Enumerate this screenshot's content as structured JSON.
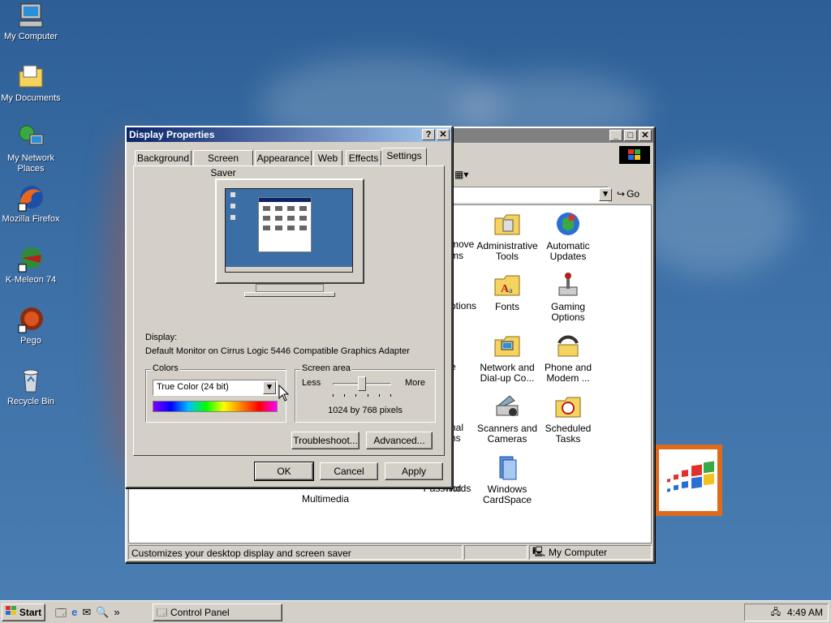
{
  "desktop": {
    "icons": [
      {
        "label": "My Computer",
        "icon": "my-computer-icon"
      },
      {
        "label": "My Documents",
        "icon": "my-documents-icon"
      },
      {
        "label": "My Network Places",
        "icon": "network-places-icon"
      },
      {
        "label": "Mozilla Firefox",
        "icon": "firefox-icon"
      },
      {
        "label": "K-Meleon 74",
        "icon": "k-meleon-icon"
      },
      {
        "label": "Pego",
        "icon": "pego-icon"
      },
      {
        "label": "Recycle Bin",
        "icon": "recycle-bin-icon"
      }
    ]
  },
  "control_panel": {
    "go_label": "Go",
    "status_left": "Customizes your desktop display and screen saver",
    "status_right": "My Computer",
    "items": [
      {
        "label": "Administrative Tools",
        "icon": "admin-tools-icon"
      },
      {
        "label": "Automatic Updates",
        "icon": "automatic-updates-icon"
      },
      {
        "label": "Fonts",
        "icon": "fonts-icon"
      },
      {
        "label": "Gaming Options",
        "icon": "gaming-options-icon"
      },
      {
        "label": "Network and Dial-up Co...",
        "icon": "network-dialup-icon"
      },
      {
        "label": "Phone and Modem ...",
        "icon": "phone-modem-icon"
      },
      {
        "label": "Scanners and Cameras",
        "icon": "scanners-cameras-icon"
      },
      {
        "label": "Scheduled Tasks",
        "icon": "scheduled-tasks-icon"
      },
      {
        "label": "Windows CardSpace",
        "icon": "cardspace-icon"
      },
      {
        "label": "Passwords",
        "icon": "passwords-icon"
      },
      {
        "label": "Multimedia",
        "icon": "multimedia-icon"
      }
    ],
    "partial_labels": [
      "move",
      "ms",
      "ptions",
      "e",
      "nal",
      "ns",
      "nd"
    ]
  },
  "dialog": {
    "title": "Display Properties",
    "tabs": [
      "Background",
      "Screen Saver",
      "Appearance",
      "Web",
      "Effects",
      "Settings"
    ],
    "active_tab": "Settings",
    "display_label": "Display:",
    "display_value": "Default Monitor on Cirrus Logic 5446 Compatible Graphics Adapter",
    "colors": {
      "group_label": "Colors",
      "selected": "True Color (24 bit)"
    },
    "screen_area": {
      "group_label": "Screen area",
      "less": "Less",
      "more": "More",
      "value_text": "1024 by 768 pixels",
      "slider_level": 0.5
    },
    "buttons": {
      "troubleshoot": "Troubleshoot...",
      "advanced": "Advanced...",
      "ok": "OK",
      "cancel": "Cancel",
      "apply": "Apply"
    }
  },
  "taskbar": {
    "start_label": "Start",
    "task_label": "Control Panel",
    "time": "4:49 AM"
  },
  "colors": {
    "desktop": "#3a6ea5",
    "title_active": "#0a246a",
    "face": "#d4d0c8"
  }
}
